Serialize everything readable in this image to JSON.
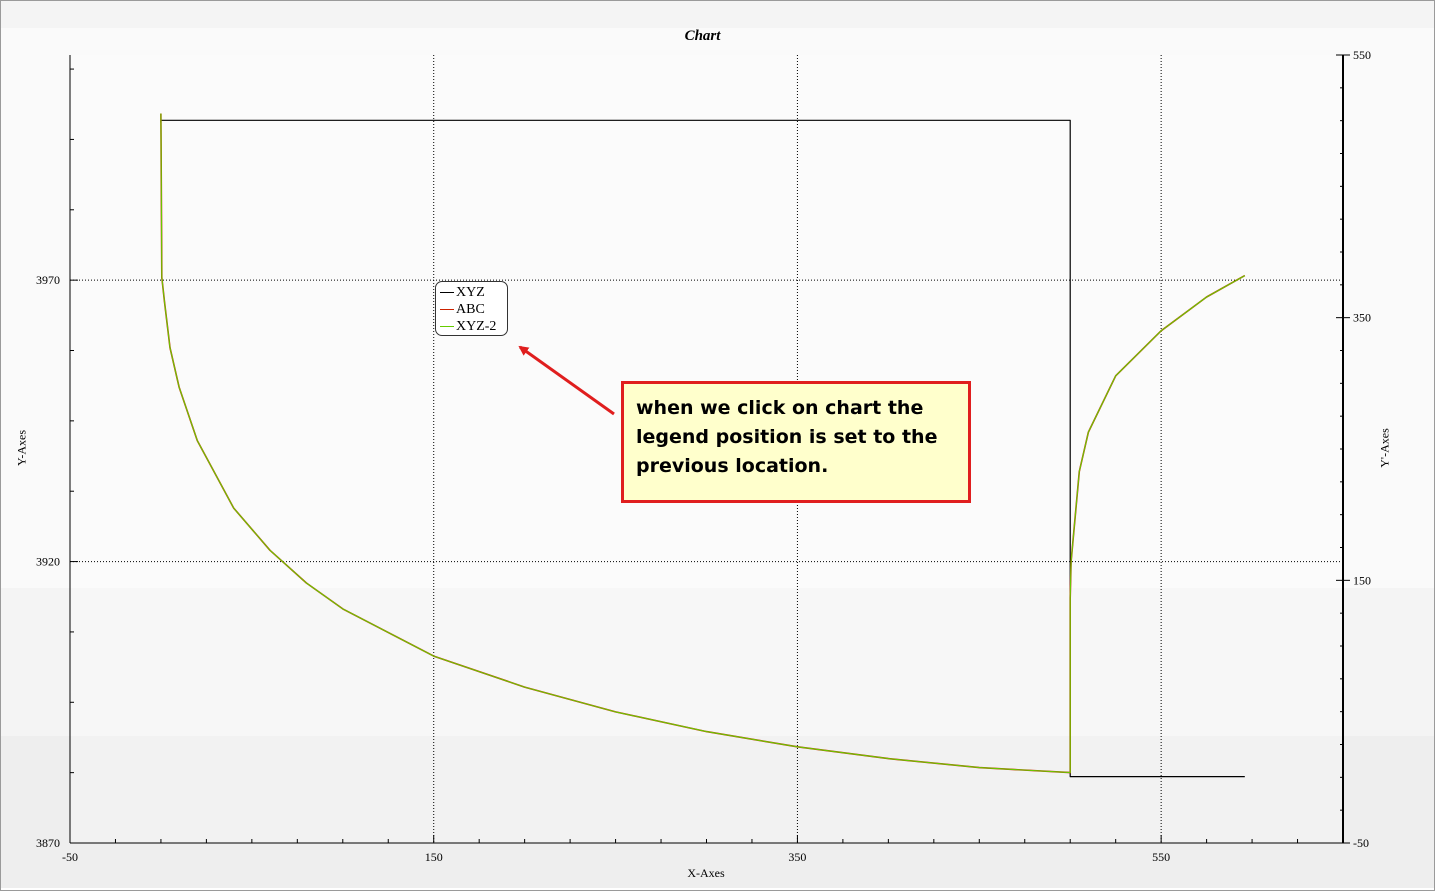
{
  "chart_data": {
    "type": "line",
    "title": "Chart",
    "xlabel": "X-Axes",
    "ylabel": "Y-Axes",
    "y2label": "Y'-Axes",
    "xlim": [
      -50,
      650
    ],
    "ylim": [
      3870,
      4010
    ],
    "y2lim": [
      -50,
      550
    ],
    "x_ticks": [
      -50,
      150,
      350,
      550
    ],
    "y_ticks": [
      3870,
      3920,
      3970
    ],
    "y2_ticks": [
      -50,
      150,
      350,
      550
    ],
    "grid": true,
    "legend_position": "upper-left",
    "series": [
      {
        "name": "XYZ",
        "color": "#000000",
        "axis": "y",
        "x": [
          0,
          0,
          500,
          500,
          596
        ],
        "y": [
          3998,
          3998.4,
          3998.4,
          3881.8,
          3881.8
        ]
      },
      {
        "name": "ABC",
        "color": "#cc2200",
        "axis": "y",
        "x": [
          0,
          0.5,
          2,
          5,
          10,
          20,
          40,
          60,
          80,
          100,
          150,
          200,
          250,
          300,
          350,
          400,
          450,
          500,
          500,
          500.5,
          505,
          510,
          525,
          550,
          575,
          596
        ],
        "y": [
          3999.6,
          3970.5,
          3966,
          3958,
          3951,
          3941.5,
          3929.5,
          3922,
          3916.2,
          3911.6,
          3903.2,
          3897.7,
          3893.3,
          3889.8,
          3887.1,
          3885,
          3883.4,
          3882.5,
          3913.5,
          3920,
          3936,
          3943,
          3953,
          3961,
          3967,
          3970.8
        ]
      },
      {
        "name": "XYZ-2",
        "color": "#66cc00",
        "axis": "y",
        "x": [
          0,
          0.5,
          2,
          5,
          10,
          20,
          40,
          60,
          80,
          100,
          150,
          200,
          250,
          300,
          350,
          400,
          450,
          500,
          500,
          500.5,
          505,
          510,
          525,
          550,
          575,
          596
        ],
        "y": [
          3999.6,
          3970.5,
          3966,
          3958,
          3951,
          3941.5,
          3929.5,
          3922,
          3916.2,
          3911.6,
          3903.2,
          3897.7,
          3893.3,
          3889.8,
          3887.1,
          3885,
          3883.4,
          3882.5,
          3913.5,
          3920,
          3936,
          3943,
          3953,
          3961,
          3967,
          3970.8
        ]
      }
    ]
  },
  "callout": {
    "lines": [
      "when we click on chart the",
      "legend position is set to the",
      "previous location."
    ],
    "border_color": "#e01e1e",
    "background": "#ffffcc"
  }
}
